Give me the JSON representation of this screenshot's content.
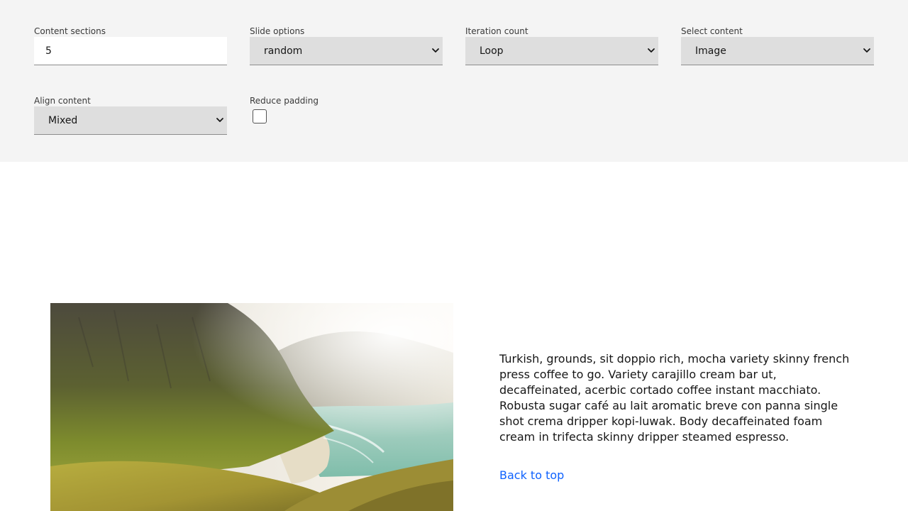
{
  "controls": {
    "content_sections": {
      "label": "Content sections",
      "value": "5"
    },
    "slide_options": {
      "label": "Slide options",
      "selected": "random"
    },
    "iteration_count": {
      "label": "Iteration count",
      "selected": "Loop"
    },
    "select_content": {
      "label": "Select content",
      "selected": "Image"
    },
    "align_content": {
      "label": "Align content",
      "selected": "Mixed"
    },
    "reduce_padding": {
      "label": "Reduce padding",
      "checked": false
    }
  },
  "content": {
    "image": {
      "subject": "mountain-valley-beach-photo"
    },
    "paragraph": "Turkish, grounds, sit doppio rich, mocha variety skinny french press coffee to go. Variety carajillo cream bar ut, decaffeinated, acerbic cortado coffee instant macchiato. Robusta sugar café au lait aromatic breve con panna single shot crema dripper kopi-luwak. Body decaffeinated foam cream in trifecta skinny dripper steamed espresso.",
    "back_to_top": "Back to top"
  },
  "colors": {
    "panel_bg": "#f4f4f4",
    "select_bg": "#dedede",
    "link": "#0f62fe",
    "text": "#161616"
  }
}
